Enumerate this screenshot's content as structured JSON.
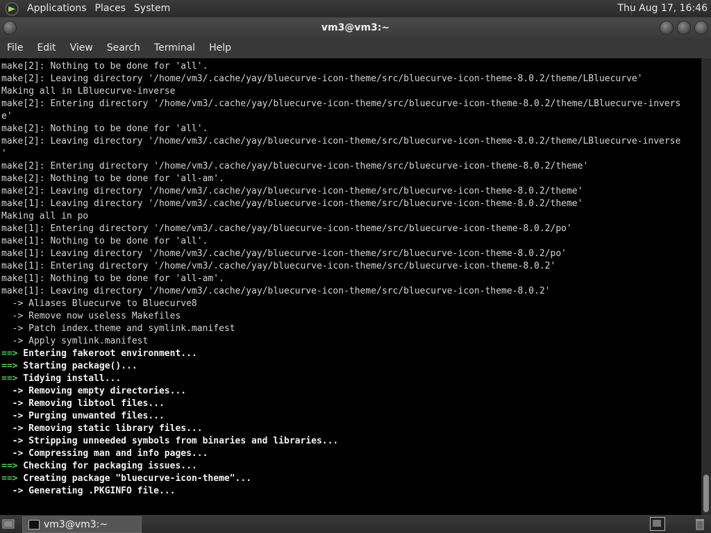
{
  "top_panel": {
    "menus": [
      "Applications",
      "Places",
      "System"
    ],
    "clock": "Thu Aug 17, 16:46"
  },
  "window": {
    "title": "vm3@vm3:~"
  },
  "menubar": {
    "items": [
      "File",
      "Edit",
      "View",
      "Search",
      "Terminal",
      "Help"
    ]
  },
  "terminal": {
    "lines": [
      {
        "text": "make[2]: Nothing to be done for 'all'."
      },
      {
        "text": "make[2]: Leaving directory '/home/vm3/.cache/yay/bluecurve-icon-theme/src/bluecurve-icon-theme-8.0.2/theme/LBluecurve'"
      },
      {
        "text": "Making all in LBluecurve-inverse"
      },
      {
        "text": "make[2]: Entering directory '/home/vm3/.cache/yay/bluecurve-icon-theme/src/bluecurve-icon-theme-8.0.2/theme/LBluecurve-invers"
      },
      {
        "text": "e'"
      },
      {
        "text": "make[2]: Nothing to be done for 'all'."
      },
      {
        "text": "make[2]: Leaving directory '/home/vm3/.cache/yay/bluecurve-icon-theme/src/bluecurve-icon-theme-8.0.2/theme/LBluecurve-inverse"
      },
      {
        "text": "'"
      },
      {
        "text": "make[2]: Entering directory '/home/vm3/.cache/yay/bluecurve-icon-theme/src/bluecurve-icon-theme-8.0.2/theme'"
      },
      {
        "text": "make[2]: Nothing to be done for 'all-am'."
      },
      {
        "text": "make[2]: Leaving directory '/home/vm3/.cache/yay/bluecurve-icon-theme/src/bluecurve-icon-theme-8.0.2/theme'"
      },
      {
        "text": "make[1]: Leaving directory '/home/vm3/.cache/yay/bluecurve-icon-theme/src/bluecurve-icon-theme-8.0.2/theme'"
      },
      {
        "text": "Making all in po"
      },
      {
        "text": "make[1]: Entering directory '/home/vm3/.cache/yay/bluecurve-icon-theme/src/bluecurve-icon-theme-8.0.2/po'"
      },
      {
        "text": "make[1]: Nothing to be done for 'all'."
      },
      {
        "text": "make[1]: Leaving directory '/home/vm3/.cache/yay/bluecurve-icon-theme/src/bluecurve-icon-theme-8.0.2/po'"
      },
      {
        "text": "make[1]: Entering directory '/home/vm3/.cache/yay/bluecurve-icon-theme/src/bluecurve-icon-theme-8.0.2'"
      },
      {
        "text": "make[1]: Nothing to be done for 'all-am'."
      },
      {
        "text": "make[1]: Leaving directory '/home/vm3/.cache/yay/bluecurve-icon-theme/src/bluecurve-icon-theme-8.0.2'"
      },
      {
        "text": "  -> Aliases Bluecurve to Bluecurve8"
      },
      {
        "text": "  -> Remove now useless Makefiles"
      },
      {
        "text": "  -> Patch index.theme and symlink.manifest"
      },
      {
        "text": "  -> Apply symlink.manifest"
      },
      {
        "prefix": "==>",
        "text": " Entering fakeroot environment...",
        "bold": true
      },
      {
        "prefix": "==>",
        "text": " Starting package()...",
        "bold": true
      },
      {
        "prefix": "==>",
        "text": " Tidying install...",
        "bold": true
      },
      {
        "text": "  -> Removing empty directories...",
        "bold": true
      },
      {
        "text": "  -> Removing libtool files...",
        "bold": true
      },
      {
        "text": "  -> Purging unwanted files...",
        "bold": true
      },
      {
        "text": "  -> Removing static library files...",
        "bold": true
      },
      {
        "text": "  -> Stripping unneeded symbols from binaries and libraries...",
        "bold": true
      },
      {
        "text": "  -> Compressing man and info pages...",
        "bold": true
      },
      {
        "prefix": "==>",
        "text": " Checking for packaging issues...",
        "bold": true
      },
      {
        "prefix": "==>",
        "text": " Creating package \"bluecurve-icon-theme\"...",
        "bold": true
      },
      {
        "text": "  -> Generating .PKGINFO file...",
        "bold": true
      }
    ]
  },
  "taskbar": {
    "task_label": "vm3@vm3:~"
  },
  "icons": {
    "logo": "gnome-foot-icon",
    "show_desktop": "show-desktop-icon",
    "task": "terminal-icon",
    "workspace": "workspace-switcher-icon",
    "trash": "trash-icon"
  },
  "colors": {
    "prompt_arrow": "#4fd14f",
    "terminal_bg": "#000000",
    "terminal_fg": "#d6d6d6"
  },
  "scrollbar": {
    "position_fraction": 1.0
  }
}
